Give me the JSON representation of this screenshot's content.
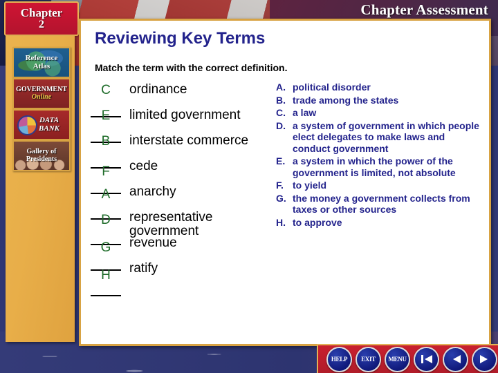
{
  "header": {
    "chapter_word": "Chapter",
    "chapter_number": "2",
    "assessment_title": "Chapter Assessment"
  },
  "sidebar": {
    "buttons": [
      {
        "name": "reference-atlas",
        "line1": "Reference",
        "line2": "Atlas"
      },
      {
        "name": "government-online",
        "line1": "GOVERNMENT",
        "line2": "Online"
      },
      {
        "name": "data-bank",
        "line1": "DATA",
        "line2": "BANK"
      },
      {
        "name": "gallery-of-presidents",
        "line1": "Gallery of",
        "line2": "Presidents"
      }
    ]
  },
  "slide": {
    "title": "Reviewing Key Terms",
    "instruction": "Match the term with the correct definition."
  },
  "terms": [
    {
      "answer": "C",
      "term": "ordinance"
    },
    {
      "answer": "E",
      "term": "limited government"
    },
    {
      "answer": "B",
      "term": "interstate commerce"
    },
    {
      "answer": "F",
      "term": "cede"
    },
    {
      "answer": "A",
      "term": "anarchy"
    },
    {
      "answer": "D",
      "term": "representative government"
    },
    {
      "answer": "G",
      "term": "revenue"
    },
    {
      "answer": "H",
      "term": "ratify"
    }
  ],
  "definitions": [
    {
      "letter": "A.",
      "text": "political disorder"
    },
    {
      "letter": "B.",
      "text": "trade among the states"
    },
    {
      "letter": "C.",
      "text": "a law"
    },
    {
      "letter": "D.",
      "text": "a system of government in which people elect delegates to make laws and conduct government"
    },
    {
      "letter": "E.",
      "text": "a system in which the power of the government is limited, not absolute"
    },
    {
      "letter": "F.",
      "text": "to yield"
    },
    {
      "letter": "G.",
      "text": "the money a government collects from taxes or other sources"
    },
    {
      "letter": "H.",
      "text": "to approve"
    }
  ],
  "navbar": {
    "buttons": [
      {
        "name": "help-button",
        "label": "HELP",
        "type": "text"
      },
      {
        "name": "exit-button",
        "label": "EXIT",
        "type": "text"
      },
      {
        "name": "menu-button",
        "label": "MENU",
        "type": "text"
      },
      {
        "name": "first-slide-button",
        "label": "",
        "type": "first"
      },
      {
        "name": "previous-slide-button",
        "label": "",
        "type": "back"
      },
      {
        "name": "next-slide-button",
        "label": "",
        "type": "forward"
      }
    ]
  },
  "colors": {
    "title_blue": "#23238c",
    "answer_green": "#1d6b28",
    "sidebar_gold": "#e8ae49",
    "badge_red": "#cf1433",
    "navbar_red": "#c9202f"
  }
}
